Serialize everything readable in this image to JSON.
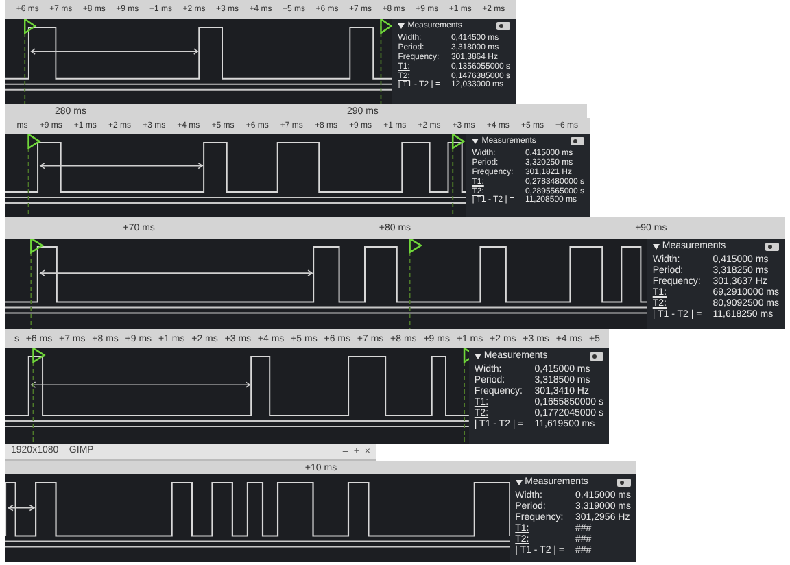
{
  "panels": [
    {
      "ruler_ticks": [
        "+6 ms",
        "+7 ms",
        "+8 ms",
        "+9 ms",
        "+1 ms",
        "+2 ms",
        "+3 ms",
        "+4 ms",
        "+5 ms",
        "+6 ms",
        "+7 ms",
        "+8 ms",
        "+9 ms",
        "+1 ms",
        "+2 ms"
      ],
      "bottom_labels": [
        "280 ms",
        "290 ms"
      ],
      "measurements": {
        "title": "Measurements",
        "expanded": true,
        "rows": [
          {
            "label": "Width:",
            "value": "0,414500 ms"
          },
          {
            "label": "Period:",
            "value": "3,318000 ms"
          },
          {
            "label": "Frequency:",
            "value": "301,3864 Hz"
          },
          {
            "label": "T1:",
            "value": "0,1356055000 s",
            "underlined": true
          },
          {
            "label": "T2:",
            "value": "0,1476385000 s",
            "underlined": true
          },
          {
            "label": "| T1 - T2 | =",
            "value": "12,033000 ms"
          }
        ]
      }
    },
    {
      "ruler_ticks": [
        "ms",
        "+9 ms",
        "+1 ms",
        "+2 ms",
        "+3 ms",
        "+4 ms",
        "+5 ms",
        "+6 ms",
        "+7 ms",
        "+8 ms",
        "+9 ms",
        "+1 ms",
        "+2 ms",
        "+3 ms",
        "+4 ms",
        "+5 ms",
        "+6 ms"
      ],
      "measurements": {
        "title": "Measurements",
        "expanded": true,
        "rows": [
          {
            "label": "Width:",
            "value": "0,415000 ms"
          },
          {
            "label": "Period:",
            "value": "3,320250 ms"
          },
          {
            "label": "Frequency:",
            "value": "301,1821 Hz"
          },
          {
            "label": "T1:",
            "value": "0,2783480000 s",
            "underlined": true
          },
          {
            "label": "T2:",
            "value": "0,2895565000 s",
            "underlined": true
          },
          {
            "label": "| T1 - T2 | =",
            "value": "11,208500 ms"
          }
        ]
      }
    },
    {
      "ruler_ticks": [
        "+70 ms",
        "+80 ms",
        "+90 ms"
      ],
      "measurements": {
        "title": "Measurements",
        "expanded": true,
        "rows": [
          {
            "label": "Width:",
            "value": "0,415000 ms"
          },
          {
            "label": "Period:",
            "value": "3,318250 ms"
          },
          {
            "label": "Frequency:",
            "value": "301,3637 Hz"
          },
          {
            "label": "T1:",
            "value": "69,2910000 ms",
            "underlined": true
          },
          {
            "label": "T2:",
            "value": "80,9092500 ms",
            "underlined": true
          },
          {
            "label": "| T1 - T2 | =",
            "value": "11,618250 ms"
          }
        ]
      }
    },
    {
      "ruler_ticks": [
        "s",
        "+6 ms",
        "+7 ms",
        "+8 ms",
        "+9 ms",
        "+1 ms",
        "+2 ms",
        "+3 ms",
        "+4 ms",
        "+5 ms",
        "+6 ms",
        "+7 ms",
        "+8 ms",
        "+9 ms",
        "+1 ms",
        "+2 ms",
        "+3 ms",
        "+4 ms",
        "+5"
      ],
      "measurements": {
        "title": "Measurements",
        "expanded": true,
        "rows": [
          {
            "label": "Width:",
            "value": "0,415000 ms"
          },
          {
            "label": "Period:",
            "value": "3,318500 ms"
          },
          {
            "label": "Frequency:",
            "value": "301,3410 Hz"
          },
          {
            "label": "T1:",
            "value": "0,1655850000 s",
            "underlined": true
          },
          {
            "label": "T2:",
            "value": "0,1772045000 s",
            "underlined": true
          },
          {
            "label": "| T1 - T2 | =",
            "value": "11,619500 ms"
          }
        ]
      }
    },
    {
      "window_title": "1920x1080 – GIMP",
      "window_buttons": [
        "–",
        "+",
        "×"
      ],
      "ruler_ticks": [
        "+10 ms"
      ],
      "measurements": {
        "title": "Measurements",
        "expanded": true,
        "rows": [
          {
            "label": "Width:",
            "value": "0,415000 ms"
          },
          {
            "label": "Period:",
            "value": "3,319000 ms"
          },
          {
            "label": "Frequency:",
            "value": "301,2956 Hz"
          },
          {
            "label": "T1:",
            "value": "###",
            "underlined": true
          },
          {
            "label": "T2:",
            "value": "###",
            "underlined": true
          },
          {
            "label": "| T1 - T2 | =",
            "value": "###"
          }
        ]
      }
    }
  ]
}
